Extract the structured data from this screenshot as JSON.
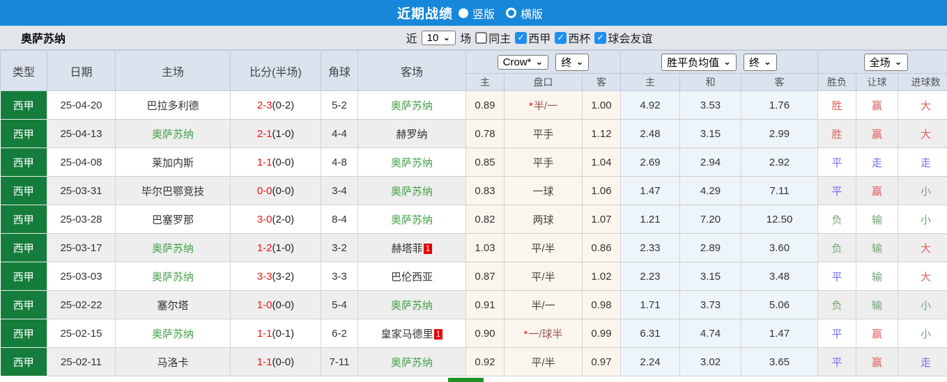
{
  "title_bar": {
    "title": "近期战绩",
    "layout_vertical_label": "竖版",
    "layout_horizontal_label": "横版"
  },
  "filter_bar": {
    "team_name": "奥萨苏纳",
    "recent_label": "近",
    "recent_count": "10",
    "matches_label": "场",
    "same_home_label": "同主",
    "league_filters": [
      "西甲",
      "西杯",
      "球会友谊"
    ]
  },
  "table": {
    "headers": {
      "type": "类型",
      "date": "日期",
      "home": "主场",
      "score": "比分(半场)",
      "corner": "角球",
      "away": "客场"
    },
    "dropdowns": {
      "company": "Crow*",
      "company_state": "终",
      "avg": "胜平负均值",
      "avg_state": "终",
      "full_match": "全场"
    },
    "sub_headers": {
      "odds_home": "主",
      "odds_handicap": "盘口",
      "odds_away": "客",
      "avg_home": "主",
      "avg_draw": "和",
      "avg_away": "客",
      "result_wdl": "胜负",
      "result_handicap": "让球",
      "result_goals": "进球数"
    },
    "colors": {
      "win_red": "#e05f5f",
      "draw_blue": "#6f6fe8",
      "lose_green": "#74a374",
      "score_red": "#ee1111",
      "self_team_green": "#44a148",
      "league_badge_green": "#157d3b",
      "topbar_blue": "#1787d9"
    },
    "rows": [
      {
        "type": "西甲",
        "date": "25-04-20",
        "home": "巴拉多利德",
        "home_self": false,
        "home_red": "",
        "score_ft": "2-3",
        "score_ht": "(0-2)",
        "corner": "5-2",
        "away": "奥萨苏纳",
        "away_self": true,
        "away_red": "",
        "odds_home": "0.89",
        "handicap": "半/一",
        "handicap_star": true,
        "odds_away": "1.00",
        "avg_home": "4.92",
        "avg_draw": "3.53",
        "avg_away": "1.76",
        "res_wdl": {
          "t": "胜",
          "c": "r-red"
        },
        "res_let": {
          "t": "赢",
          "c": "r-red"
        },
        "res_goal": {
          "t": "大",
          "c": "r-red"
        }
      },
      {
        "type": "西甲",
        "date": "25-04-13",
        "home": "奥萨苏纳",
        "home_self": true,
        "home_red": "",
        "score_ft": "2-1",
        "score_ht": "(1-0)",
        "corner": "4-4",
        "away": "赫罗纳",
        "away_self": false,
        "away_red": "",
        "odds_home": "0.78",
        "handicap": "平手",
        "handicap_star": false,
        "odds_away": "1.12",
        "avg_home": "2.48",
        "avg_draw": "3.15",
        "avg_away": "2.99",
        "res_wdl": {
          "t": "胜",
          "c": "r-red"
        },
        "res_let": {
          "t": "赢",
          "c": "r-red"
        },
        "res_goal": {
          "t": "大",
          "c": "r-red"
        }
      },
      {
        "type": "西甲",
        "date": "25-04-08",
        "home": "莱加内斯",
        "home_self": false,
        "home_red": "",
        "score_ft": "1-1",
        "score_ht": "(0-0)",
        "corner": "4-8",
        "away": "奥萨苏纳",
        "away_self": true,
        "away_red": "",
        "odds_home": "0.85",
        "handicap": "平手",
        "handicap_star": false,
        "odds_away": "1.04",
        "avg_home": "2.69",
        "avg_draw": "2.94",
        "avg_away": "2.92",
        "res_wdl": {
          "t": "平",
          "c": "r-blue"
        },
        "res_let": {
          "t": "走",
          "c": "r-blue"
        },
        "res_goal": {
          "t": "走",
          "c": "r-blue"
        }
      },
      {
        "type": "西甲",
        "date": "25-03-31",
        "home": "毕尔巴鄂竞技",
        "home_self": false,
        "home_red": "",
        "score_ft": "0-0",
        "score_ht": "(0-0)",
        "corner": "3-4",
        "away": "奥萨苏纳",
        "away_self": true,
        "away_red": "",
        "odds_home": "0.83",
        "handicap": "一球",
        "handicap_star": false,
        "odds_away": "1.06",
        "avg_home": "1.47",
        "avg_draw": "4.29",
        "avg_away": "7.11",
        "res_wdl": {
          "t": "平",
          "c": "r-blue"
        },
        "res_let": {
          "t": "赢",
          "c": "r-red"
        },
        "res_goal": {
          "t": "小",
          "c": "r-green"
        }
      },
      {
        "type": "西甲",
        "date": "25-03-28",
        "home": "巴塞罗那",
        "home_self": false,
        "home_red": "",
        "score_ft": "3-0",
        "score_ht": "(2-0)",
        "corner": "8-4",
        "away": "奥萨苏纳",
        "away_self": true,
        "away_red": "",
        "odds_home": "0.82",
        "handicap": "两球",
        "handicap_star": false,
        "odds_away": "1.07",
        "avg_home": "1.21",
        "avg_draw": "7.20",
        "avg_away": "12.50",
        "res_wdl": {
          "t": "负",
          "c": "r-green"
        },
        "res_let": {
          "t": "输",
          "c": "r-green"
        },
        "res_goal": {
          "t": "小",
          "c": "r-green"
        }
      },
      {
        "type": "西甲",
        "date": "25-03-17",
        "home": "奥萨苏纳",
        "home_self": true,
        "home_red": "",
        "score_ft": "1-2",
        "score_ht": "(1-0)",
        "corner": "3-2",
        "away": "赫塔菲",
        "away_self": false,
        "away_red": "1",
        "odds_home": "1.03",
        "handicap": "平/半",
        "handicap_star": false,
        "odds_away": "0.86",
        "avg_home": "2.33",
        "avg_draw": "2.89",
        "avg_away": "3.60",
        "res_wdl": {
          "t": "负",
          "c": "r-green"
        },
        "res_let": {
          "t": "输",
          "c": "r-green"
        },
        "res_goal": {
          "t": "大",
          "c": "r-red"
        }
      },
      {
        "type": "西甲",
        "date": "25-03-03",
        "home": "奥萨苏纳",
        "home_self": true,
        "home_red": "",
        "score_ft": "3-3",
        "score_ht": "(3-2)",
        "corner": "3-3",
        "away": "巴伦西亚",
        "away_self": false,
        "away_red": "",
        "odds_home": "0.87",
        "handicap": "平/半",
        "handicap_star": false,
        "odds_away": "1.02",
        "avg_home": "2.23",
        "avg_draw": "3.15",
        "avg_away": "3.48",
        "res_wdl": {
          "t": "平",
          "c": "r-blue"
        },
        "res_let": {
          "t": "输",
          "c": "r-green"
        },
        "res_goal": {
          "t": "大",
          "c": "r-red"
        }
      },
      {
        "type": "西甲",
        "date": "25-02-22",
        "home": "塞尔塔",
        "home_self": false,
        "home_red": "",
        "score_ft": "1-0",
        "score_ht": "(0-0)",
        "corner": "5-4",
        "away": "奥萨苏纳",
        "away_self": true,
        "away_red": "",
        "odds_home": "0.91",
        "handicap": "半/一",
        "handicap_star": false,
        "odds_away": "0.98",
        "avg_home": "1.71",
        "avg_draw": "3.73",
        "avg_away": "5.06",
        "res_wdl": {
          "t": "负",
          "c": "r-green"
        },
        "res_let": {
          "t": "输",
          "c": "r-green"
        },
        "res_goal": {
          "t": "小",
          "c": "r-green"
        }
      },
      {
        "type": "西甲",
        "date": "25-02-15",
        "home": "奥萨苏纳",
        "home_self": true,
        "home_red": "",
        "score_ft": "1-1",
        "score_ht": "(0-1)",
        "corner": "6-2",
        "away": "皇家马德里",
        "away_self": false,
        "away_red": "1",
        "odds_home": "0.90",
        "handicap": "一/球半",
        "handicap_star": true,
        "odds_away": "0.99",
        "avg_home": "6.31",
        "avg_draw": "4.74",
        "avg_away": "1.47",
        "res_wdl": {
          "t": "平",
          "c": "r-blue"
        },
        "res_let": {
          "t": "赢",
          "c": "r-red"
        },
        "res_goal": {
          "t": "小",
          "c": "r-green"
        }
      },
      {
        "type": "西甲",
        "date": "25-02-11",
        "home": "马洛卡",
        "home_self": false,
        "home_red": "",
        "score_ft": "1-1",
        "score_ht": "(0-0)",
        "corner": "7-11",
        "away": "奥萨苏纳",
        "away_self": true,
        "away_red": "",
        "odds_home": "0.92",
        "handicap": "平/半",
        "handicap_star": false,
        "odds_away": "0.97",
        "avg_home": "2.24",
        "avg_draw": "3.02",
        "avg_away": "3.65",
        "res_wdl": {
          "t": "平",
          "c": "r-blue"
        },
        "res_let": {
          "t": "赢",
          "c": "r-red"
        },
        "res_goal": {
          "t": "走",
          "c": "r-blue"
        }
      }
    ]
  }
}
